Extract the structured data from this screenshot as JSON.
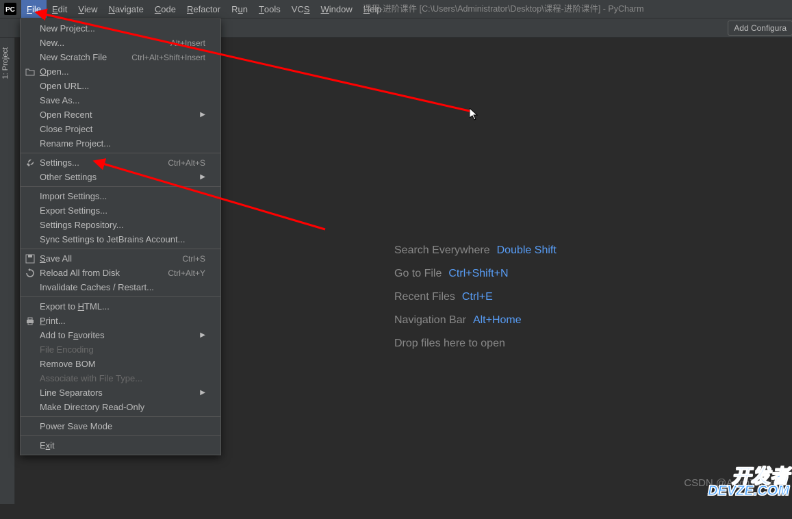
{
  "title_bar": {
    "project_label": "课程-进阶课件",
    "project_path": "[C:\\Users\\Administrator\\Desktop\\课程-进阶课件]",
    "app_name": "PyCharm"
  },
  "menubar": [
    {
      "letter": "F",
      "rest": "ile",
      "name": "file",
      "active": true
    },
    {
      "letter": "E",
      "rest": "dit",
      "name": "edit"
    },
    {
      "letter": "V",
      "rest": "iew",
      "name": "view"
    },
    {
      "letter": "N",
      "rest": "avigate",
      "name": "navigate"
    },
    {
      "letter": "C",
      "rest": "ode",
      "name": "code"
    },
    {
      "letter": "R",
      "rest": "efactor",
      "name": "refactor"
    },
    {
      "letter": "",
      "rest": "R",
      "name": "run",
      "u2": "u",
      "rest2": "n"
    },
    {
      "letter": "T",
      "rest": "ools",
      "name": "tools"
    },
    {
      "letter": "",
      "rest": "VC",
      "name": "vcs",
      "u2": "S",
      "rest2": ""
    },
    {
      "letter": "W",
      "rest": "indow",
      "name": "window"
    },
    {
      "letter": "H",
      "rest": "elp",
      "name": "help"
    }
  ],
  "toolbar": {
    "add_config": "Add Configura"
  },
  "left_gutter": {
    "project_tab": "1: Project"
  },
  "welcome": {
    "hints": [
      {
        "label": "Search Everywhere",
        "shortcut": "Double Shift"
      },
      {
        "label": "Go to File",
        "shortcut": "Ctrl+Shift+N"
      },
      {
        "label": "Recent Files",
        "shortcut": "Ctrl+E"
      },
      {
        "label": "Navigation Bar",
        "shortcut": "Alt+Home"
      }
    ],
    "drop": "Drop files here to open"
  },
  "watermark": {
    "csdn": "CSDN @ArvinTarget",
    "devze_l1": "开发者",
    "devze_l2": "DEVZE.COM"
  },
  "file_menu": {
    "groups": [
      [
        {
          "label": "New Project...",
          "name": "new-project"
        },
        {
          "label": "New...",
          "name": "new",
          "shortcut": "Alt+Insert"
        },
        {
          "label": "New Scratch File",
          "name": "new-scratch",
          "shortcut": "Ctrl+Alt+Shift+Insert"
        },
        {
          "label": "Open...",
          "name": "open",
          "icon": "folder-open-icon",
          "ul": "O",
          "rest": "pen..."
        },
        {
          "label": "Open URL...",
          "name": "open-url"
        },
        {
          "label": "Save As...",
          "name": "save-as"
        },
        {
          "label": "Open Recent",
          "name": "open-recent",
          "submenu": true
        },
        {
          "label": "Close Project",
          "name": "close-project"
        },
        {
          "label": "Rename Project...",
          "name": "rename-project"
        }
      ],
      [
        {
          "label": "Settings...",
          "name": "settings",
          "icon": "wrench-icon",
          "shortcut": "Ctrl+Alt+S"
        },
        {
          "label": "Other Settings",
          "name": "other-settings",
          "submenu": true
        }
      ],
      [
        {
          "label": "Import Settings...",
          "name": "import-settings"
        },
        {
          "label": "Export Settings...",
          "name": "export-settings"
        },
        {
          "label": "Settings Repository...",
          "name": "settings-repo"
        },
        {
          "label": "Sync Settings to JetBrains Account...",
          "name": "sync-settings"
        }
      ],
      [
        {
          "label": "Save All",
          "name": "save-all",
          "icon": "save-icon",
          "shortcut": "Ctrl+S",
          "ul": "S",
          "rest": "ave All"
        },
        {
          "label": "Reload All from Disk",
          "name": "reload",
          "icon": "reload-icon",
          "shortcut": "Ctrl+Alt+Y"
        },
        {
          "label": "Invalidate Caches / Restart...",
          "name": "invalidate"
        }
      ],
      [
        {
          "label": "Export to HTML...",
          "name": "export-html",
          "ul_text": "Export to ",
          "ul": "H",
          "rest": "TML..."
        },
        {
          "label": "Print...",
          "name": "print",
          "icon": "print-icon",
          "ul": "P",
          "rest": "rint..."
        },
        {
          "label": "Add to Favorites",
          "name": "add-favorites",
          "submenu": true,
          "ul_text": "Add to F",
          "ul": "a",
          "rest": "vorites"
        },
        {
          "label": "File Encoding",
          "name": "file-encoding",
          "disabled": true
        },
        {
          "label": "Remove BOM",
          "name": "remove-bom"
        },
        {
          "label": "Associate with File Type...",
          "name": "associate",
          "disabled": true
        },
        {
          "label": "Line Separators",
          "name": "line-separators",
          "submenu": true
        },
        {
          "label": "Make Directory Read-Only",
          "name": "make-readonly"
        }
      ],
      [
        {
          "label": "Power Save Mode",
          "name": "power-save"
        }
      ],
      [
        {
          "label": "Exit",
          "name": "exit",
          "ul_text": "E",
          "ul": "x",
          "rest": "it"
        }
      ]
    ]
  }
}
